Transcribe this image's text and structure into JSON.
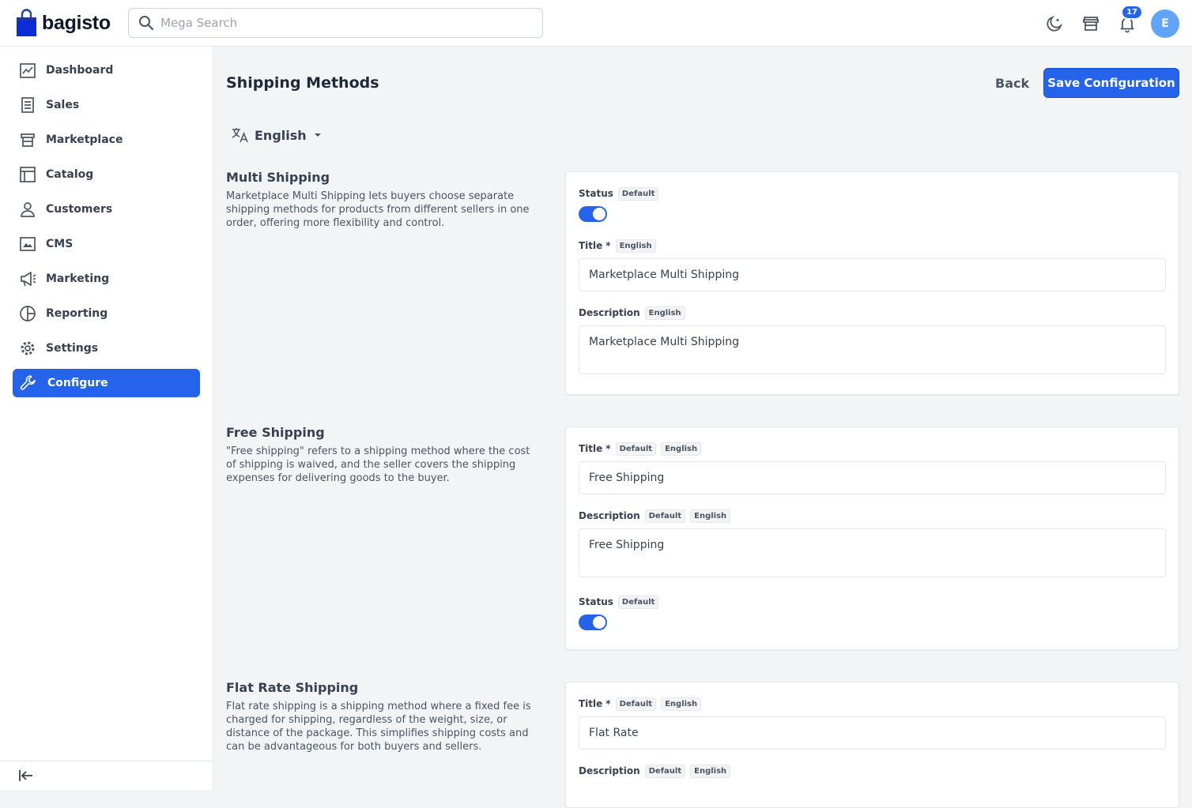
{
  "brand": {
    "name": "bagisto"
  },
  "search": {
    "placeholder": "Mega Search"
  },
  "header": {
    "notification_count": "17",
    "avatar_initial": "E"
  },
  "sidebar": {
    "items": [
      {
        "label": "Dashboard",
        "icon": "dashboard-icon"
      },
      {
        "label": "Sales",
        "icon": "sales-icon"
      },
      {
        "label": "Marketplace",
        "icon": "store-icon"
      },
      {
        "label": "Catalog",
        "icon": "catalog-icon"
      },
      {
        "label": "Customers",
        "icon": "customer-icon"
      },
      {
        "label": "CMS",
        "icon": "cms-icon"
      },
      {
        "label": "Marketing",
        "icon": "megaphone-icon"
      },
      {
        "label": "Reporting",
        "icon": "pie-chart-icon"
      },
      {
        "label": "Settings",
        "icon": "gear-icon"
      },
      {
        "label": "Configure",
        "icon": "wrench-icon",
        "active": true
      }
    ]
  },
  "page": {
    "title": "Shipping Methods",
    "back_label": "Back",
    "save_label": "Save Configuration",
    "locale": "English"
  },
  "sections": {
    "multi": {
      "title": "Multi Shipping",
      "description": "Marketplace Multi Shipping lets buyers choose separate shipping methods for products from different sellers in one order, offering more flexibility and control.",
      "status_label": "Status",
      "status_tag": "Default",
      "status_on": true,
      "title_label": "Title",
      "title_tag": "English",
      "title_value": "Marketplace Multi Shipping",
      "desc_label": "Description",
      "desc_tag": "English",
      "desc_value": "Marketplace Multi Shipping"
    },
    "free": {
      "title": "Free Shipping",
      "description": "\"Free shipping\" refers to a shipping method where the cost of shipping is waived, and the seller covers the shipping expenses for delivering goods to the buyer.",
      "title_label": "Title",
      "title_tag1": "Default",
      "title_tag2": "English",
      "title_value": "Free Shipping",
      "desc_label": "Description",
      "desc_tag1": "Default",
      "desc_tag2": "English",
      "desc_value": "Free Shipping",
      "status_label": "Status",
      "status_tag": "Default",
      "status_on": true
    },
    "flat": {
      "title": "Flat Rate Shipping",
      "description": "Flat rate shipping is a shipping method where a fixed fee is charged for shipping, regardless of the weight, size, or distance of the package. This simplifies shipping costs and can be advantageous for both buyers and sellers.",
      "title_label": "Title",
      "title_tag1": "Default",
      "title_tag2": "English",
      "title_value": "Flat Rate",
      "desc_label": "Description",
      "desc_tag1": "Default",
      "desc_tag2": "English"
    }
  },
  "colors": {
    "accent": "#2563eb"
  }
}
